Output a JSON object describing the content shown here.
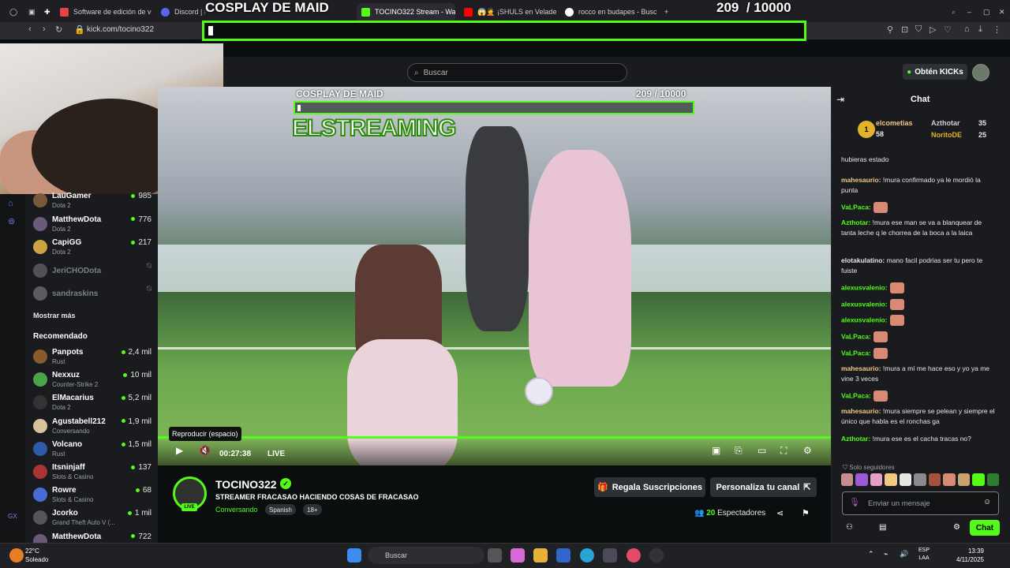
{
  "browser": {
    "tabs": [
      {
        "label": "Software de edición de vi",
        "color": "#e64444"
      },
      {
        "label": "Discord | #",
        "color": "#5865f2"
      },
      {
        "label": "TOCINO322 Stream - Wa",
        "color": "#53fc18"
      },
      {
        "label": "😱🤦 ¡SHULS en Velade",
        "color": "#ff0000"
      },
      {
        "label": "rocco en budapes - Busc",
        "color": "#ffffff"
      }
    ],
    "url": "kick.com/tocino322"
  },
  "goal_overlay": {
    "title": "COSPLAY DE MAID",
    "current": "209",
    "target": "/ 10000",
    "progress": 0.0209
  },
  "header": {
    "search_placeholder": "Buscar",
    "get_kicks": "Obtén KICKs"
  },
  "sidebar": {
    "following": [
      {
        "name": "LauGamer",
        "game": "Dota 2",
        "viewers": "985",
        "color": "#7b5a3c"
      },
      {
        "name": "MatthewDota",
        "game": "Dota 2",
        "viewers": "776",
        "color": "#6b5b7a"
      },
      {
        "name": "CapiGG",
        "game": "Dota 2",
        "viewers": "217",
        "color": "#c9a441"
      },
      {
        "name": "JeriCHODota",
        "game": "",
        "viewers": "⍉",
        "color": "#777777"
      },
      {
        "name": "sandraskins",
        "game": "",
        "viewers": "⍉",
        "color": "#888888"
      }
    ],
    "show_more": "Mostrar más",
    "recommended_title": "Recomendado",
    "recommended": [
      {
        "name": "Panpots",
        "game": "Rust",
        "viewers": "2,4 mil",
        "color": "#8a5a2f"
      },
      {
        "name": "Nexxuz",
        "game": "Counter-Strike 2",
        "viewers": "10 mil",
        "color": "#4aa54a"
      },
      {
        "name": "ElMacarius",
        "game": "Dota 2",
        "viewers": "5,2 mil",
        "color": "#333333"
      },
      {
        "name": "Agustabell212",
        "game": "Conversando",
        "viewers": "1,9 mil",
        "color": "#d9c39a"
      },
      {
        "name": "Volcano",
        "game": "Rust",
        "viewers": "1,5 mil",
        "color": "#2e5aa8"
      },
      {
        "name": "Itsninjaff",
        "game": "Slots & Casino",
        "viewers": "137",
        "color": "#a33"
      },
      {
        "name": "Rowre",
        "game": "Slots & Casino",
        "viewers": "68",
        "color": "#4a6bd6"
      },
      {
        "name": "Jcorko",
        "game": "Grand Theft Auto V (...",
        "viewers": "1 mil",
        "color": "#555555"
      },
      {
        "name": "MatthewDota",
        "game": "",
        "viewers": "722",
        "color": "#6b5b7a"
      }
    ]
  },
  "video": {
    "inner_title": "COSPLAY DE MAID",
    "inner_count": "209  / 10000",
    "watermark": "ELSTREAMING",
    "tooltip": "Reproducir (espacio)",
    "time": "00:27:38",
    "live": "LIVE"
  },
  "channel": {
    "name": "TOCINO322",
    "title": "STREAMER FRACASAO HACIENDO COSAS DE FRACASAO",
    "category": "Conversando",
    "tags": [
      "Spanish",
      "18+"
    ],
    "live_badge": "LIVE",
    "gift_subs": "Regala Suscripciones",
    "customize": "Personaliza tu canal",
    "viewer_count": "20",
    "viewer_label": "Espectadores"
  },
  "chat": {
    "title": "Chat",
    "leaderboard": [
      {
        "name": "elcometias",
        "value": "58"
      },
      {
        "name": "Azthotar",
        "value": "35"
      },
      {
        "name": "NoritoDE",
        "value": "25"
      }
    ],
    "messages": [
      {
        "user": "",
        "text": "hubieras estado",
        "color": "#e6e6e6"
      },
      {
        "user": "mahesaurio:",
        "text": " !mura confirmado ya le mordió la punta",
        "color": "#f0c987"
      },
      {
        "user": "VaLPaca:",
        "text": "",
        "color": "#53fc18",
        "emote": true
      },
      {
        "user": "Azthotar:",
        "text": " !mura ese man se va a blanquear de tanta leche q le chorrea de la boca a la laica",
        "color": "#53fc18"
      },
      {
        "user": "elotakulatino:",
        "text": " mano facil podrias ser tu pero te fuiste",
        "color": "#e6e6e6"
      },
      {
        "user": "alexusvalenio:",
        "text": "",
        "color": "#53fc18",
        "emote": true
      },
      {
        "user": "alexusvalenio:",
        "text": "",
        "color": "#53fc18",
        "emote": true
      },
      {
        "user": "alexusvalenio:",
        "text": "",
        "color": "#53fc18",
        "emote": true
      },
      {
        "user": "VaLPaca:",
        "text": "",
        "color": "#53fc18",
        "emote": true
      },
      {
        "user": "VaLPaca:",
        "text": "",
        "color": "#53fc18",
        "emote": true
      },
      {
        "user": "mahesaurio:",
        "text": " !mura a mí me hace eso y yo ya me vine 3 veces",
        "color": "#f0c987"
      },
      {
        "user": "VaLPaca:",
        "text": "",
        "color": "#53fc18",
        "emote": true
      },
      {
        "user": "mahesaurio:",
        "text": " !mura siempre se pelean y siempre el único que habla es el ronchas ga",
        "color": "#f0c987"
      },
      {
        "user": "Azthotar:",
        "text": " !mura ese es el cacha tracas no?",
        "color": "#53fc18"
      }
    ],
    "followers_only": "Solo seguidores",
    "input_placeholder": "Enviar un mensaje",
    "send": "Chat"
  },
  "taskbar": {
    "temp": "22°C",
    "weather": "Soleado",
    "search": "Buscar",
    "lang1": "ESP",
    "lang2": "LAA",
    "time": "13:39",
    "date": "4/11/2025"
  }
}
